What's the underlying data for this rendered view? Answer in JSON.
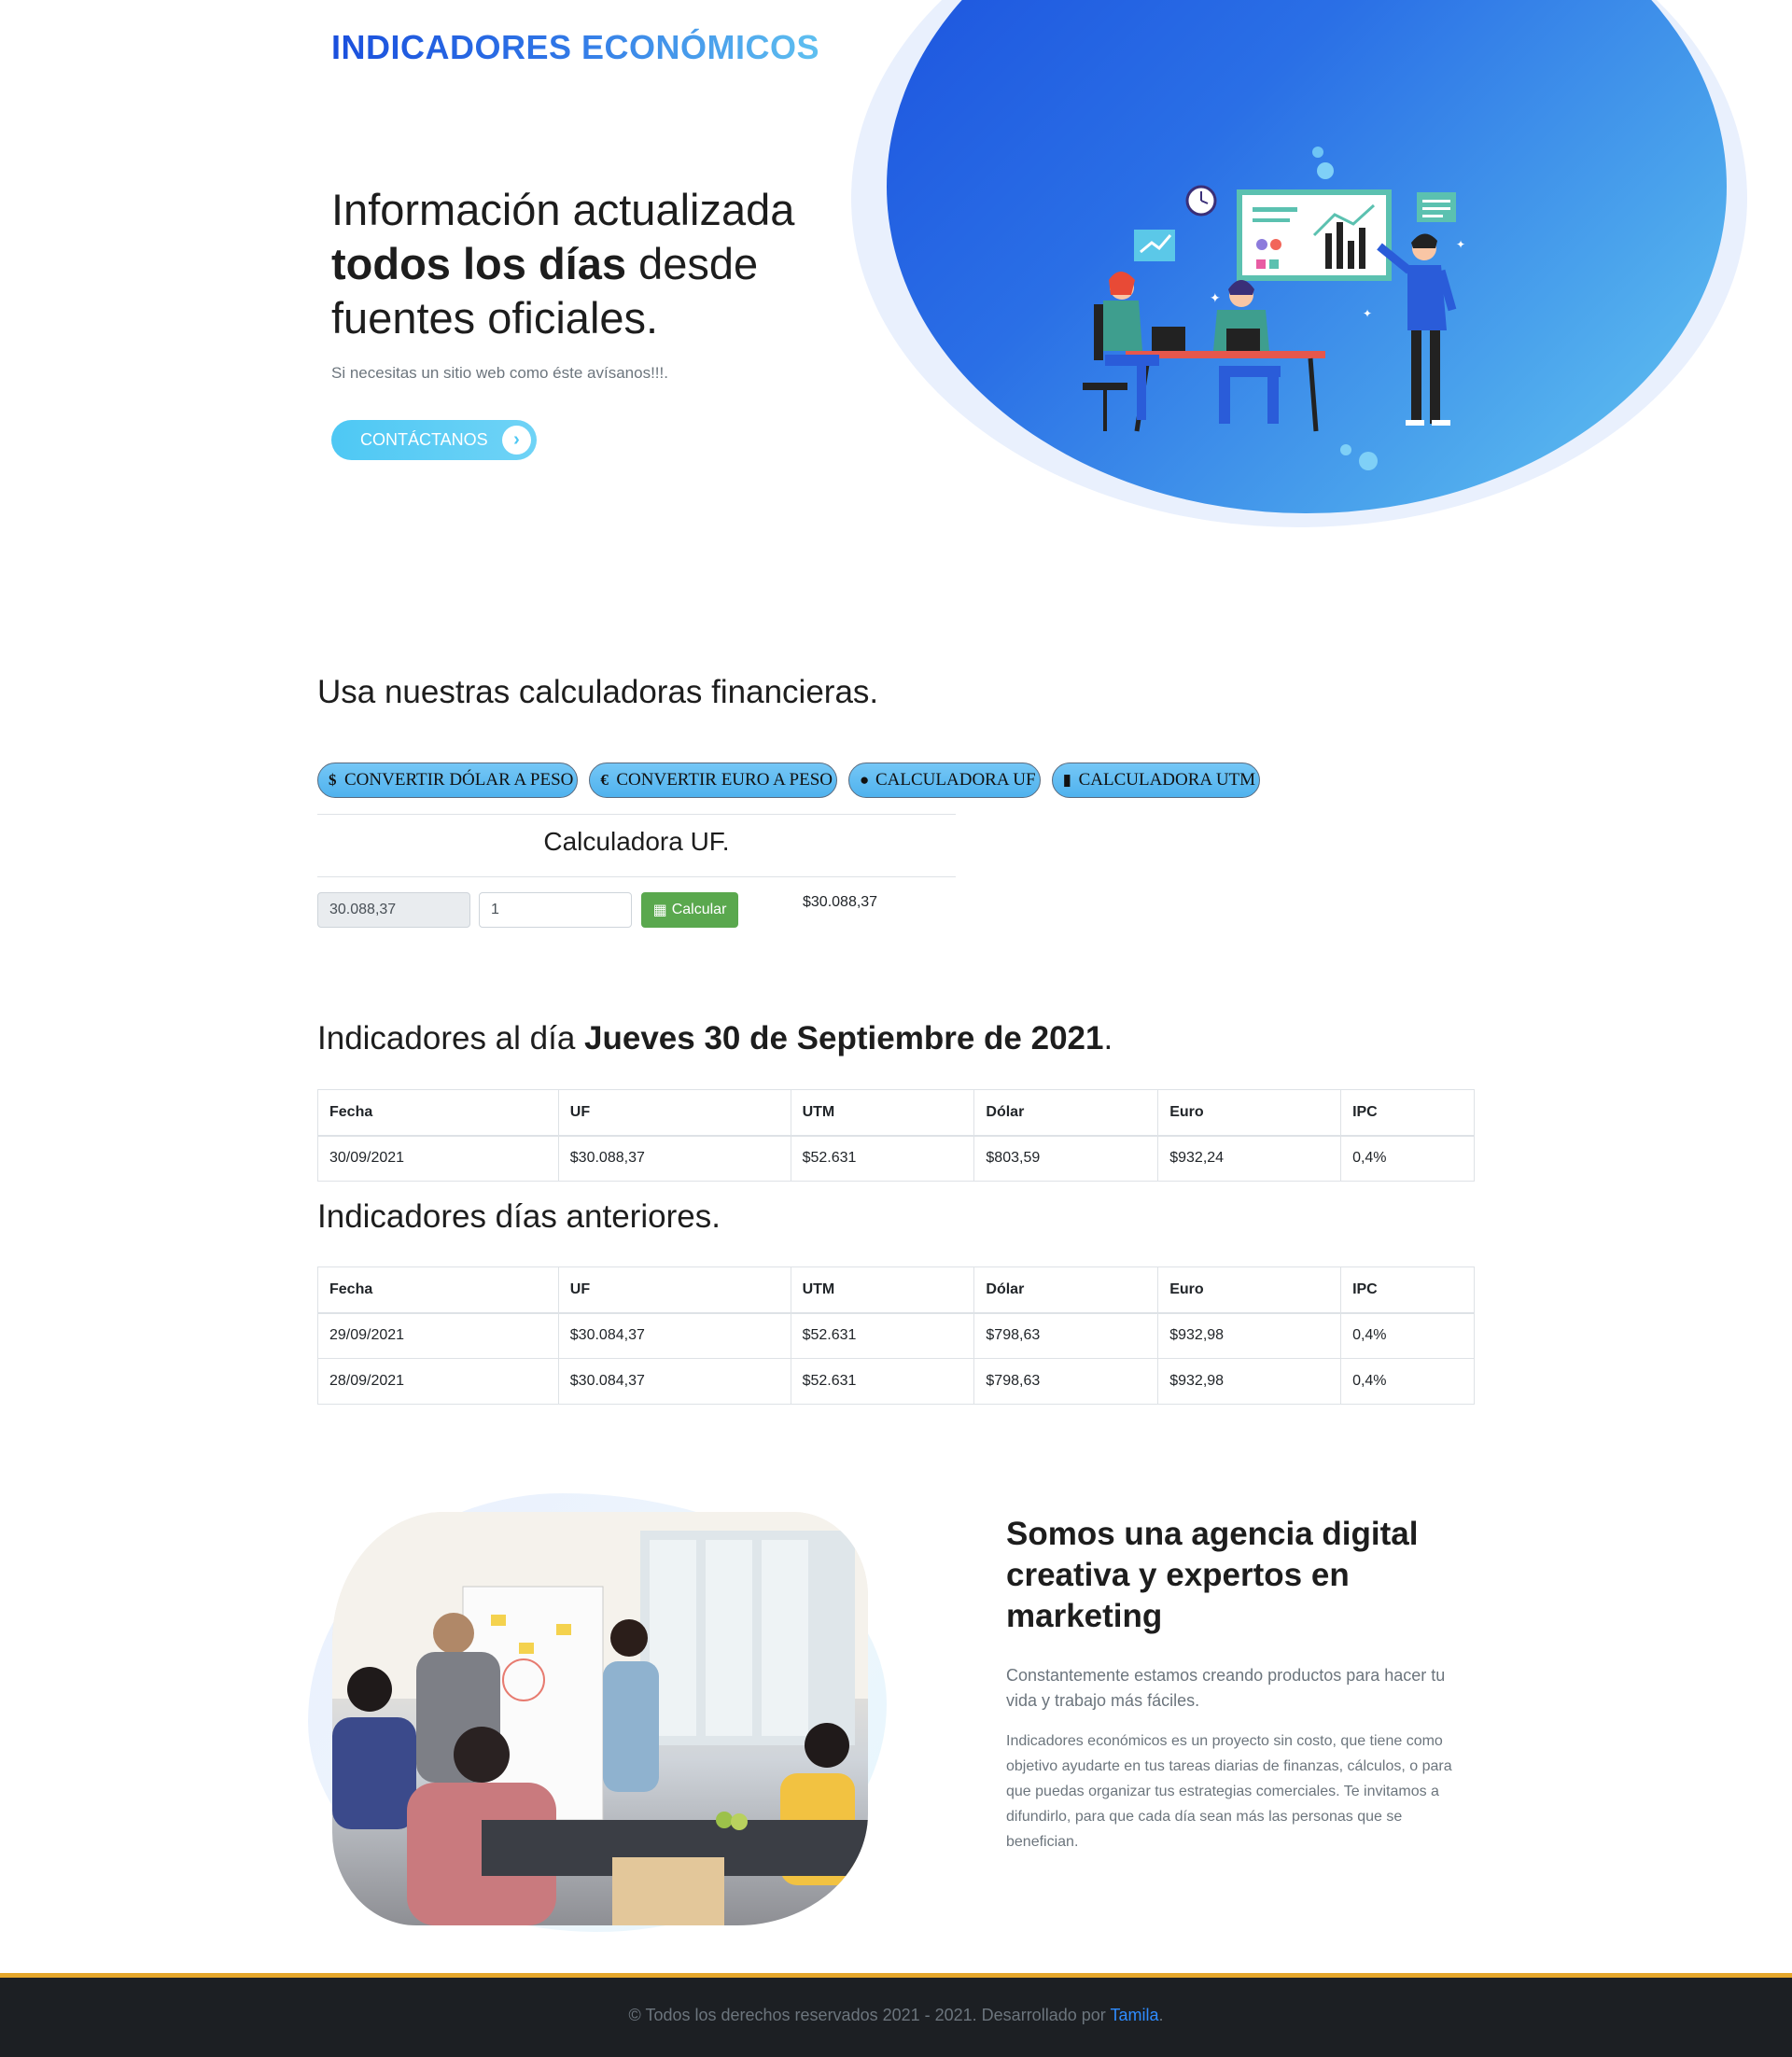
{
  "header": {
    "logo": "INDICADORES ECONÓMICOS"
  },
  "hero": {
    "title_part1": "Información actualizada",
    "title_bold": "todos los días",
    "title_part2": "desde fuentes oficiales.",
    "subtitle": "Si necesitas un sitio web como éste avísanos!!!.",
    "cta_label": "CONTÁCTANOS",
    "cta_icon": "chevron-right-icon"
  },
  "calculators": {
    "title": "Usa nuestras calculadoras financieras.",
    "tabs": [
      {
        "label": "CONVERTIR DÓLAR A PESO",
        "icon": "dollar-icon",
        "glyph": "$"
      },
      {
        "label": "CONVERTIR EURO A PESO",
        "icon": "euro-icon",
        "glyph": "€"
      },
      {
        "label": "CALCULADORA UF",
        "icon": "money-bag-icon",
        "glyph": "●"
      },
      {
        "label": "CALCULADORA UTM",
        "icon": "document-dollar-icon",
        "glyph": "▮"
      }
    ],
    "active_panel_title": "Calculadora UF.",
    "rate_value": "30.088,37",
    "quantity_value": "1",
    "button_label": "Calcular",
    "result": "$30.088,37"
  },
  "today": {
    "title_prefix": "Indicadores al día",
    "title_date": "Jueves 30 de Septiembre de 2021",
    "title_suffix": ".",
    "columns": [
      "Fecha",
      "UF",
      "UTM",
      "Dólar",
      "Euro",
      "IPC"
    ],
    "rows": [
      [
        "30/09/2021",
        "$30.088,37",
        "$52.631",
        "$803,59",
        "$932,24",
        "0,4%"
      ]
    ]
  },
  "previous": {
    "title": "Indicadores días anteriores.",
    "columns": [
      "Fecha",
      "UF",
      "UTM",
      "Dólar",
      "Euro",
      "IPC"
    ],
    "rows": [
      [
        "29/09/2021",
        "$30.084,37",
        "$52.631",
        "$798,63",
        "$932,98",
        "0,4%"
      ],
      [
        "28/09/2021",
        "$30.084,37",
        "$52.631",
        "$798,63",
        "$932,98",
        "0,4%"
      ]
    ]
  },
  "about": {
    "title": "Somos una agencia digital creativa y expertos en marketing",
    "lead": "Constantemente estamos creando productos para hacer tu vida y trabajo más fáciles.",
    "text": "Indicadores económicos es un proyecto sin costo, que tiene como objetivo ayudarte en tus tareas diarias de finanzas, cálculos, o para que puedas organizar tus estrategias comerciales. Te invitamos a difundirlo, para que cada día sean más las personas que se benefician."
  },
  "footer": {
    "text": "© Todos los derechos reservados 2021 - 2021. Desarrollado por",
    "link_label": "Tamila",
    "suffix": "."
  },
  "colors": {
    "brand_blue": "#1a4fdd",
    "accent_cyan": "#4ec8f4",
    "calc_button": "#5aa84e",
    "footer_bg": "#1c1f23",
    "footer_border": "#e5a72b"
  }
}
